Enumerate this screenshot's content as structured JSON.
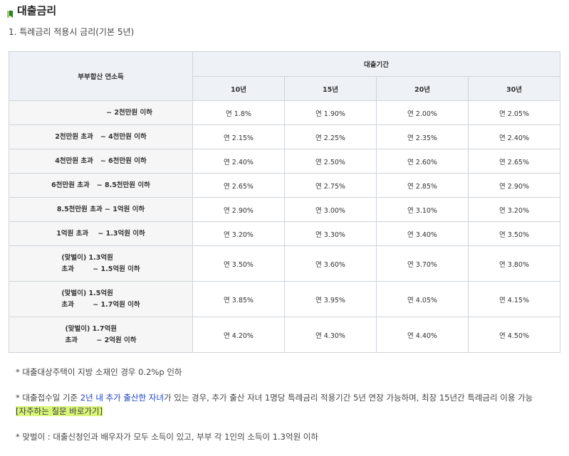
{
  "heading": {
    "title": "대출금리",
    "icon": "green-bookmark-icon",
    "icon_color": "#2f7d32"
  },
  "subheading": "1. 특례금리 적용시 금리(기본 5년)",
  "table": {
    "row_header": "부부합산 연소득",
    "period_header": "대출기간",
    "periods": [
      "10년",
      "15년",
      "20년",
      "30년"
    ],
    "rows": [
      {
        "label_lines": [
          "~ 2천만원 이하"
        ],
        "values": [
          "연 1.8%",
          "연 1.90%",
          "연 2.00%",
          "연 2.05%"
        ]
      },
      {
        "label_lines": [
          "2천만원 초과   ~ 4천만원 이하"
        ],
        "values": [
          "연 2.15%",
          "연 2.25%",
          "연 2.35%",
          "연 2.40%"
        ]
      },
      {
        "label_lines": [
          "4천만원 초과   ~ 6천만원 이하"
        ],
        "values": [
          "연 2.40%",
          "연 2.50%",
          "연 2.60%",
          "연 2.65%"
        ]
      },
      {
        "label_lines": [
          "6천만원 초과   ~ 8.5천만원 이하"
        ],
        "values": [
          "연 2.65%",
          "연 2.75%",
          "연 2.85%",
          "연 2.90%"
        ]
      },
      {
        "label_lines": [
          "8.5천만원 초과 ~ 1억원 이하"
        ],
        "values": [
          "연 2.90%",
          "연 3.00%",
          "연 3.10%",
          "연 3.20%"
        ]
      },
      {
        "label_lines": [
          "1억원 초과    ~ 1.3억원 이하"
        ],
        "values": [
          "연 3.20%",
          "연 3.30%",
          "연 3.40%",
          "연 3.50%"
        ]
      },
      {
        "label_lines": [
          "(맞벌이) 1.3억원",
          "초과        ~ 1.5억원 이하"
        ],
        "values": [
          "연 3.50%",
          "연 3.60%",
          "연 3.70%",
          "연 3.80%"
        ]
      },
      {
        "label_lines": [
          "(맞벌이) 1.5억원",
          "초과        ~ 1.7억원 이하"
        ],
        "values": [
          "연 3.85%",
          "연 3.95%",
          "연 4.05%",
          "연 4.15%"
        ]
      },
      {
        "label_lines": [
          "(맞벌이) 1.7억원",
          "초과        ~ 2억원 이하"
        ],
        "values": [
          "연 4.20%",
          "연 4.30%",
          "연 4.40%",
          "연 4.50%"
        ]
      }
    ]
  },
  "notes": {
    "note1": "* 대출대상주택이 지방 소재인 경우 0.2%p 인하",
    "note2_pre": "* 대출접수일 기준 ",
    "note2_blue": "2년 내 추가 출산한 자녀",
    "note2_mid": "가 있는 경우, 추가 출산 자녀 1명당 특례금리 적용기간 5년 연장 가능하며, 최장 15년간 특례금리 이용 가능",
    "note2_link": "[자주하는 질문 바로가기]",
    "note3": "* 맞벌이 : 대출신청인과 배우자가 모두 소득이 있고, 부부 각 1인의 소득이 1.3억원 이하"
  },
  "colors": {
    "accent_blue": "#1a3fc4",
    "link_highlight": "#d9f57a",
    "header_bg": "#eef1f6",
    "label_bg": "#f6f6f6"
  }
}
